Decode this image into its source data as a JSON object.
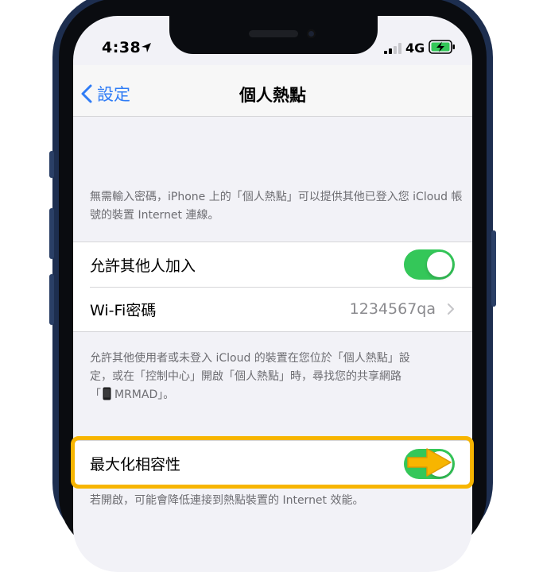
{
  "status_bar": {
    "time": "4:38",
    "network": "4G"
  },
  "nav": {
    "back_label": "設定",
    "title": "個人熱點"
  },
  "intro_footnote": "無需輸入密碼，iPhone 上的「個人熱點」可以提供其他已登入您 iCloud 帳號的裝置 Internet 連線。",
  "settings": {
    "allow_others": {
      "label": "允許其他人加入",
      "on": true
    },
    "wifi_password": {
      "label": "Wi-Fi密碼",
      "value": "1234567qa"
    }
  },
  "discovery_footnote": {
    "line1": "允許其他使用者或未登入 iCloud 的裝置在您位於「個人熱點」設",
    "line2": "定，或在「控制中心」開啟「個人熱點」時，尋找您的共享網路",
    "line3_prefix": "「",
    "device_name": "MRMAD",
    "line3_suffix": "」。"
  },
  "compatibility": {
    "label": "最大化相容性",
    "on": true
  },
  "compatibility_footnote": "若開啟，可能會降低連接到熱點裝置的 Internet 效能。",
  "colors": {
    "accent": "#2f7cf6",
    "toggle_on": "#34c759",
    "highlight": "#f7b500"
  },
  "icons": [
    "location-arrow-icon",
    "signal-bars-icon",
    "battery-charging-icon",
    "chevron-left-icon",
    "chevron-right-icon",
    "phone-icon",
    "pointer-arrow-icon"
  ]
}
